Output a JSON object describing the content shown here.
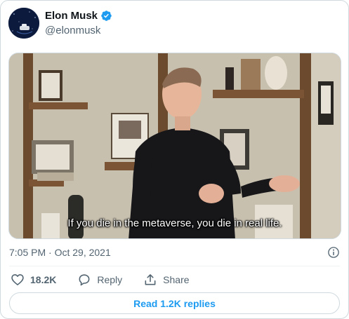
{
  "author": {
    "display_name": "Elon Musk",
    "handle": "@elonmusk",
    "verified": true,
    "verified_color": "#1d9bf0"
  },
  "media": {
    "subtitle": "If you die in the metaverse, you die in real life."
  },
  "timestamp": "7:05 PM · Oct 29, 2021",
  "actions": {
    "likes": "18.2K",
    "reply_label": "Reply",
    "share_label": "Share"
  },
  "read_replies_label": "Read 1.2K replies",
  "colors": {
    "accent": "#1d9bf0",
    "secondary_text": "#536471",
    "border": "#cfd9de"
  },
  "icons": {
    "like": "heart-icon",
    "reply": "reply-bubble-icon",
    "share": "share-upload-icon",
    "info": "info-icon",
    "verified": "verified-badge-icon"
  }
}
